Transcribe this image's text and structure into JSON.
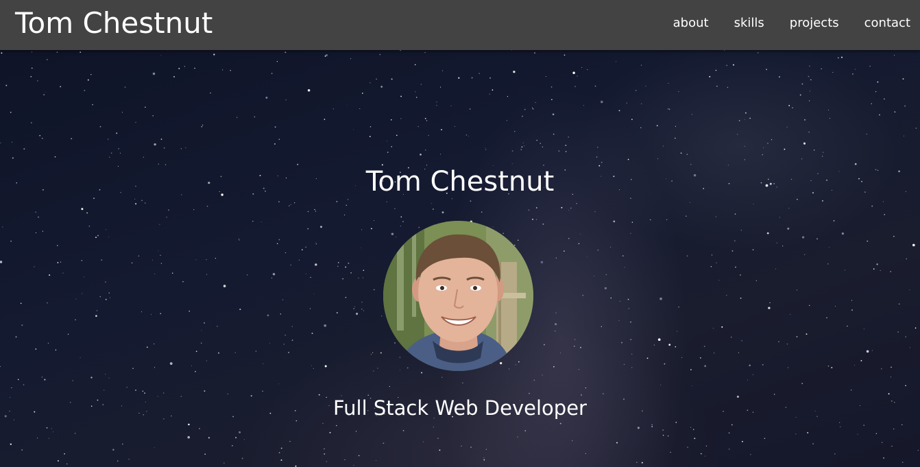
{
  "navbar": {
    "brand": "Tom Chestnut",
    "links": [
      {
        "label": "about"
      },
      {
        "label": "skills"
      },
      {
        "label": "projects"
      },
      {
        "label": "contact"
      }
    ],
    "background_color": "#434343"
  },
  "hero": {
    "title": "Tom Chestnut",
    "subtitle": "Full Stack Web Developer",
    "background": "starry-night-sky",
    "avatar": "profile-photo"
  }
}
